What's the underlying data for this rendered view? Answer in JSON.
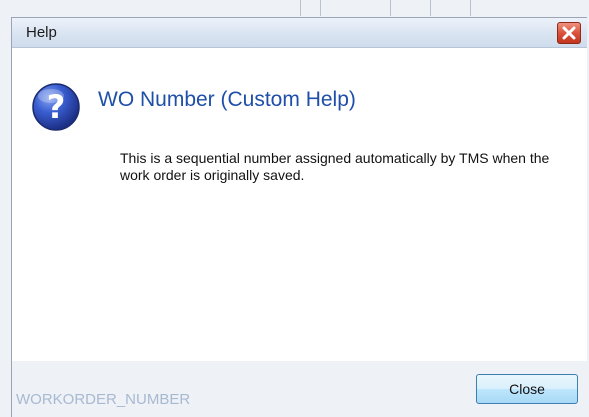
{
  "dialog": {
    "title": "Help",
    "heading": "WO Number (Custom Help)",
    "body": "This is a sequential number assigned automatically by TMS when the work order is originally saved.",
    "field_code": "WORKORDER_NUMBER",
    "close_button_label": "Close",
    "icons": {
      "help": "help-question-icon",
      "close": "close-x-icon"
    }
  },
  "colors": {
    "heading": "#1f4fa8",
    "field_code": "#a8b9d2",
    "close_x": "#d9533c"
  }
}
